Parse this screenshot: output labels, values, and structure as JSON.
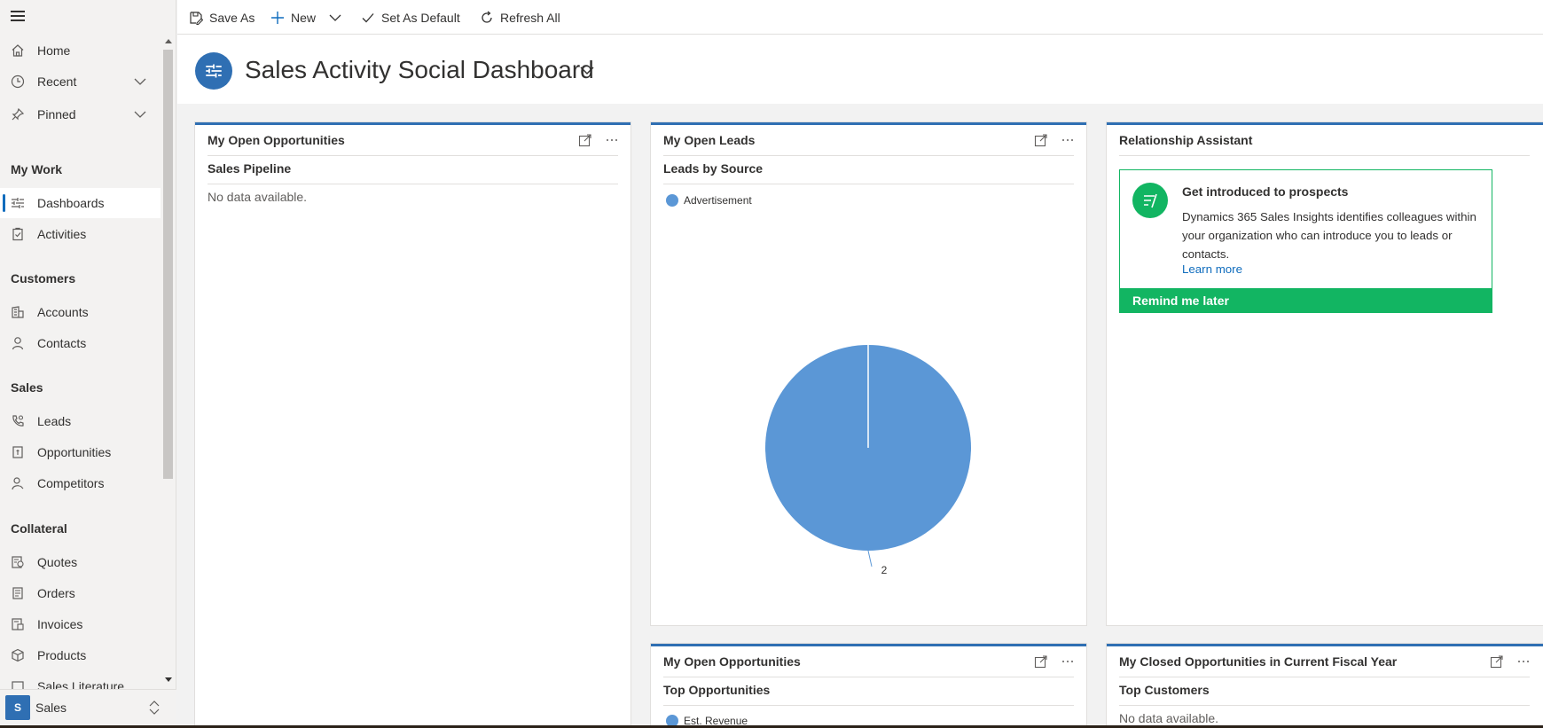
{
  "command_bar": {
    "save_as": "Save As",
    "new": "New",
    "set_as_default": "Set As Default",
    "refresh_all": "Refresh All"
  },
  "sidebar": {
    "items_top": [
      {
        "label": "Home",
        "icon": "home-icon"
      },
      {
        "label": "Recent",
        "icon": "clock-icon"
      },
      {
        "label": "Pinned",
        "icon": "pin-icon"
      }
    ],
    "sections": {
      "my_work": "My Work",
      "customers": "Customers",
      "sales": "Sales",
      "collateral": "Collateral"
    },
    "my_work_items": [
      "Dashboards",
      "Activities"
    ],
    "customers_items": [
      "Accounts",
      "Contacts"
    ],
    "sales_items": [
      "Leads",
      "Opportunities",
      "Competitors"
    ],
    "collateral_items": [
      "Quotes",
      "Orders",
      "Invoices",
      "Products",
      "Sales Literature"
    ],
    "area": {
      "badge": "S",
      "label": "Sales"
    }
  },
  "header": {
    "title": "Sales Activity Social Dashboard"
  },
  "cards": {
    "open_opps": {
      "title": "My Open Opportunities",
      "subtitle": "Sales Pipeline",
      "empty": "No data available."
    },
    "open_leads": {
      "title": "My Open Leads",
      "subtitle": "Leads by Source",
      "legend": "Advertisement"
    },
    "relationship": {
      "title": "Relationship Assistant",
      "heading": "Get introduced to prospects",
      "body": "Dynamics 365 Sales Insights identifies colleagues within your organization who can introduce you to leads or contacts.",
      "link": "Learn more",
      "button": "Remind me later"
    },
    "open_opps_2": {
      "title": "My Open Opportunities",
      "subtitle": "Top Opportunities",
      "legend": "Est. Revenue"
    },
    "closed_opps": {
      "title": "My Closed Opportunities in Current Fiscal Year",
      "subtitle": "Top Customers",
      "empty": "No data available."
    }
  },
  "chart_data": {
    "type": "pie",
    "title": "Leads by Source",
    "categories": [
      "Advertisement"
    ],
    "values": [
      2
    ],
    "data_labels": [
      "2"
    ],
    "colors": [
      "#5b97d6"
    ]
  }
}
